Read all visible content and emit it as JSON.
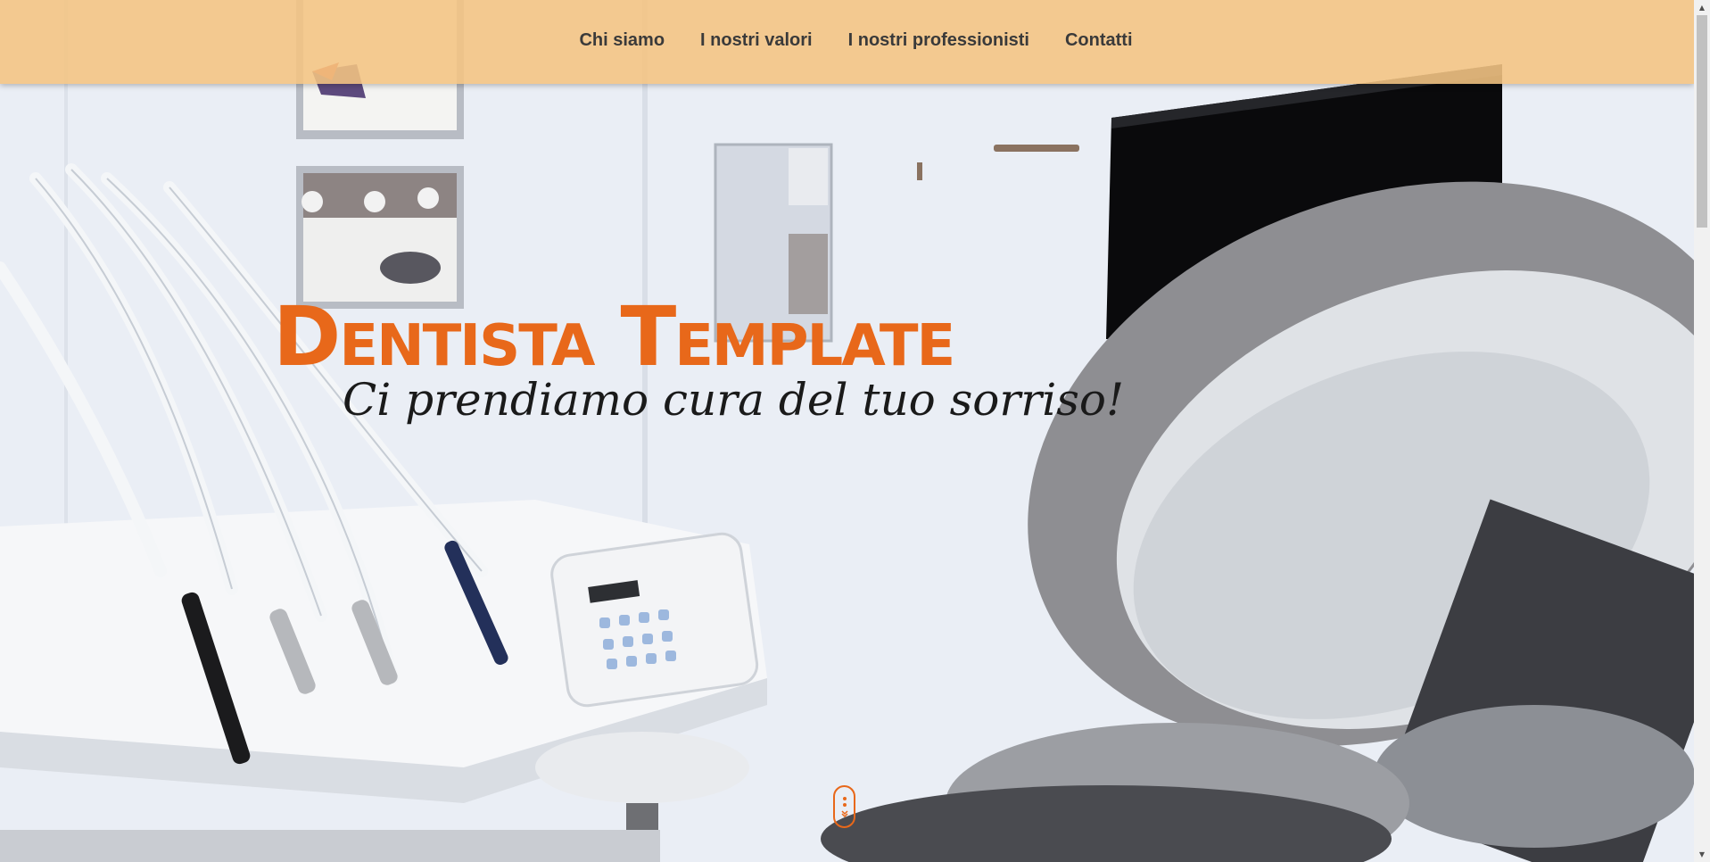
{
  "nav": {
    "items": [
      {
        "label": "Chi siamo"
      },
      {
        "label": "I nostri valori"
      },
      {
        "label": "I nostri professionisti"
      },
      {
        "label": "Contatti"
      }
    ]
  },
  "hero": {
    "title": "Dentista Template",
    "subtitle": "Ci prendiamo cura del tuo sorriso!",
    "background_image": "dental-office-photo"
  },
  "scroll_indicator": {
    "icon": "mouse-scroll-icon"
  },
  "colors": {
    "accent": "#e8681a",
    "nav_background": "#f4c482",
    "nav_text": "#3a3a3a",
    "subtitle_text": "#1a1a1a"
  }
}
